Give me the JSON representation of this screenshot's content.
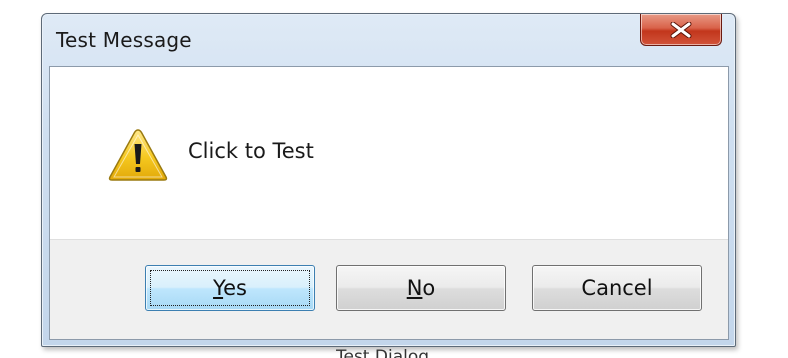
{
  "window": {
    "title": "Test Message"
  },
  "titlebar": {
    "close_icon": "close-x-icon",
    "close_color": "#c2361c"
  },
  "message": {
    "icon": "warning-triangle-icon",
    "icon_color": "#f2c21d",
    "text": "Click to Test"
  },
  "buttons": {
    "yes": {
      "label_prefix": "",
      "label_mnemonic": "Y",
      "label_rest": "es",
      "default": true
    },
    "no": {
      "label_prefix": "",
      "label_mnemonic": "N",
      "label_rest": "o",
      "default": false
    },
    "cancel": {
      "label": "Cancel",
      "default": false
    }
  },
  "caption": {
    "text": "Test Dialog"
  }
}
